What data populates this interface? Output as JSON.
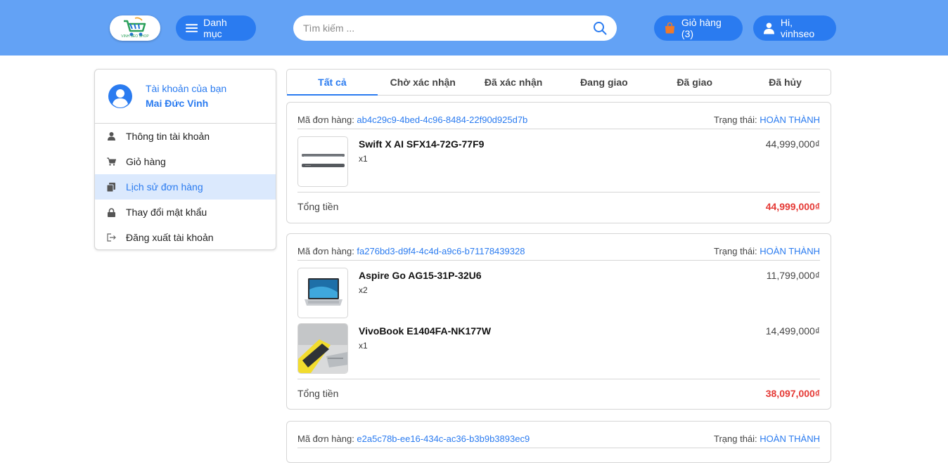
{
  "header": {
    "logo_text": "VINH SEO SHOP",
    "menu_label": "Danh mục",
    "search_placeholder": "Tìm kiếm ...",
    "cart_label": "Giỏ hàng (3)",
    "user_label": "Hi, vinhseo"
  },
  "sidebar": {
    "account_title": "Tài khoản của bạn",
    "account_name": "Mai Đức Vinh",
    "items": [
      {
        "label": "Thông tin tài khoản",
        "icon": "user-icon"
      },
      {
        "label": "Giỏ hàng",
        "icon": "cart-icon"
      },
      {
        "label": "Lịch sử đơn hàng",
        "icon": "history-icon"
      },
      {
        "label": "Thay đổi mật khẩu",
        "icon": "lock-icon"
      },
      {
        "label": "Đăng xuất tài khoản",
        "icon": "logout-icon"
      }
    ]
  },
  "tabs": [
    "Tất cả",
    "Chờ xác nhận",
    "Đã xác nhận",
    "Đang giao",
    "Đã giao",
    "Đã hủy"
  ],
  "labels": {
    "order_id": "Mã đơn hàng: ",
    "status": "Trạng thái: ",
    "total": "Tổng tiền"
  },
  "orders": [
    {
      "id": "ab4c29c9-4bed-4c96-8484-22f90d925d7b",
      "status": "HOÀN THÀNH",
      "items": [
        {
          "name": "Swift X AI SFX14-72G-77F9",
          "qty": "x1",
          "price": "44,999,000₫"
        }
      ],
      "total": "44,999,000₫"
    },
    {
      "id": "fa276bd3-d9f4-4c4d-a9c6-b71178439328",
      "status": "HOÀN THÀNH",
      "items": [
        {
          "name": "Aspire Go AG15-31P-32U6",
          "qty": "x2",
          "price": "11,799,000₫"
        },
        {
          "name": "VivoBook E1404FA-NK177W",
          "qty": "x1",
          "price": "14,499,000₫"
        }
      ],
      "total": "38,097,000₫"
    },
    {
      "id": "e2a5c78b-ee16-434c-ac36-b3b9b3893ec9",
      "status": "HOÀN THÀNH"
    }
  ],
  "colors": {
    "header_bg": "#63a2f5",
    "primary": "#2a7bf0",
    "total_red": "#e53935",
    "active_bg": "#dbe9fd"
  }
}
